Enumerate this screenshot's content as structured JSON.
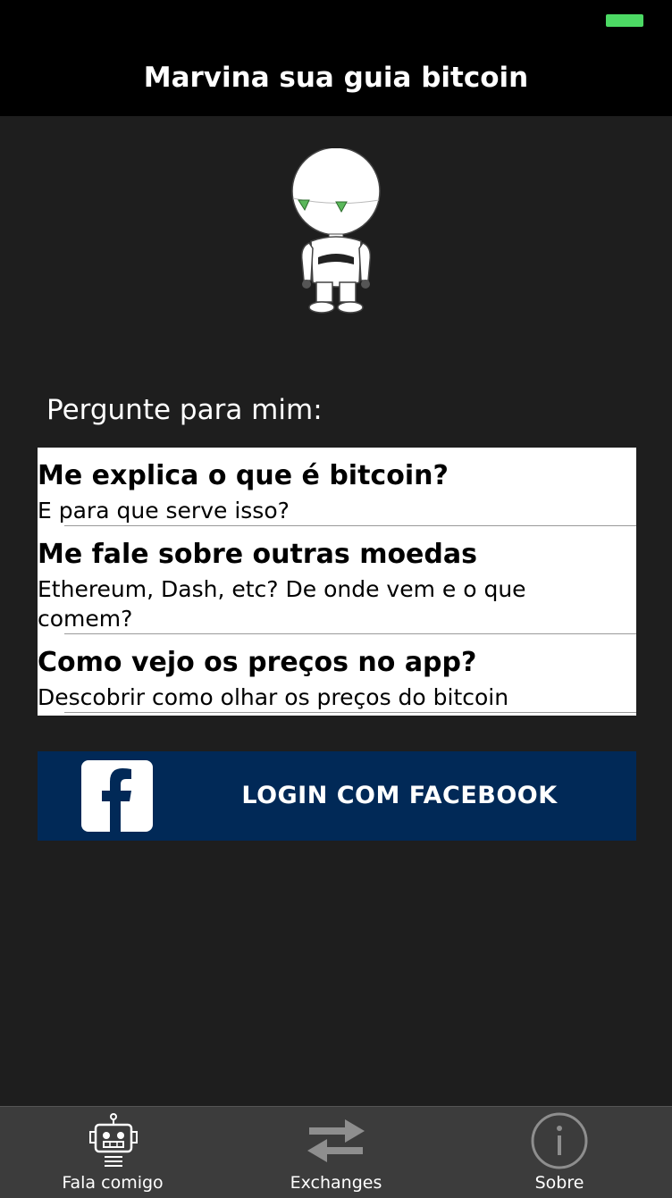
{
  "header": {
    "title": "Marvina sua guia bitcoin"
  },
  "status": {
    "battery_color": "#4cd964"
  },
  "prompt": "Pergunte para mim:",
  "questions": [
    {
      "title": "Me explica o que é bitcoin?",
      "subtitle": "E para que serve isso?"
    },
    {
      "title": "Me fale sobre outras moedas",
      "subtitle": "Ethereum, Dash, etc? De onde vem e o que comem?"
    },
    {
      "title": "Como vejo os preços no app?",
      "subtitle": "Descobrir como olhar os preços do bitcoin"
    }
  ],
  "facebook": {
    "label": "LOGIN COM FACEBOOK",
    "icon": "facebook-icon",
    "color": "#012957"
  },
  "tabs": [
    {
      "label": "Fala comigo",
      "icon": "robot-icon"
    },
    {
      "label": "Exchanges",
      "icon": "exchange-arrows-icon"
    },
    {
      "label": "Sobre",
      "icon": "info-icon"
    }
  ]
}
